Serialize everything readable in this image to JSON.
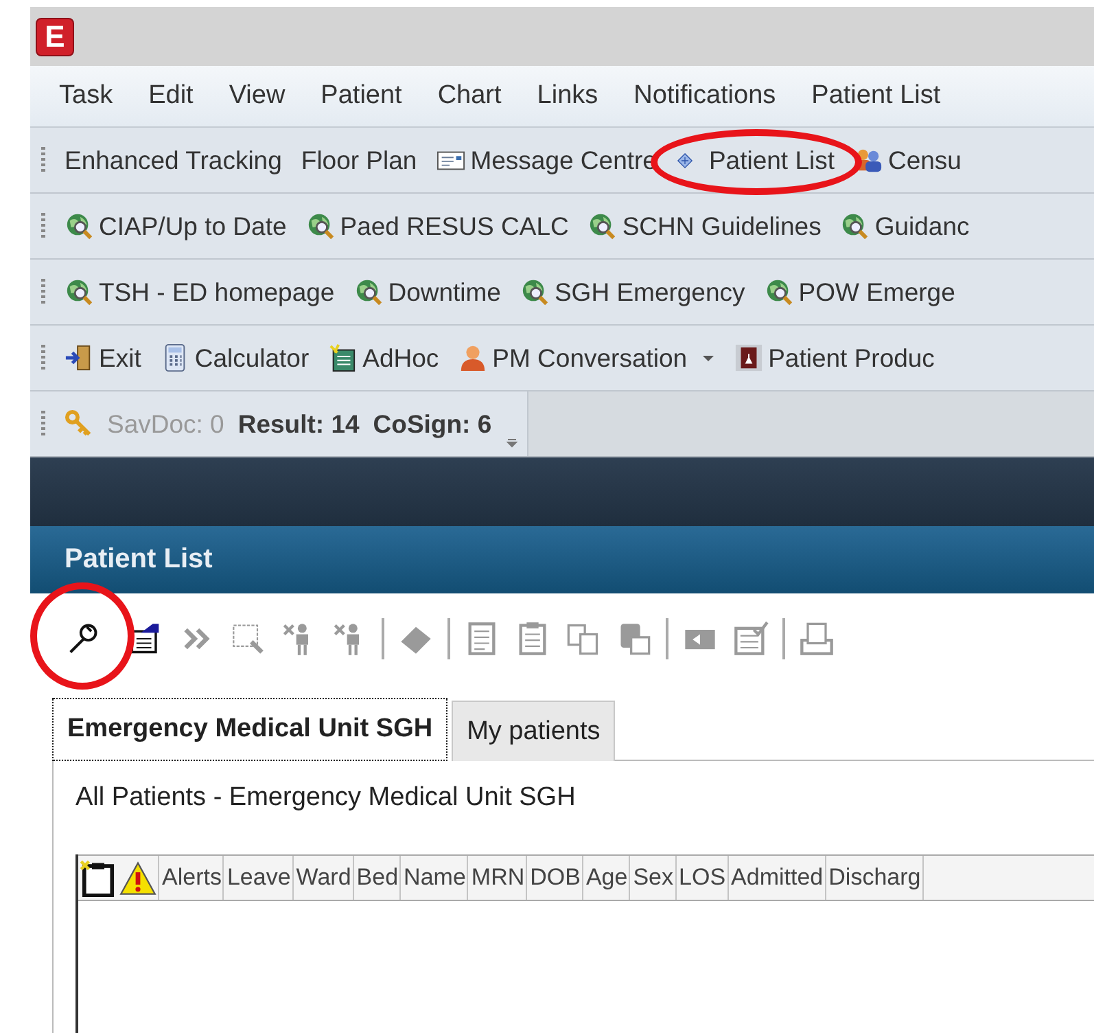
{
  "app_icon": {
    "letter": "E"
  },
  "annotations": [
    {
      "kind": "circle"
    },
    {
      "kind": "circle"
    }
  ],
  "menu": [
    "Task",
    "Edit",
    "View",
    "Patient",
    "Chart",
    "Links",
    "Notifications",
    "Patient List"
  ],
  "toolbars": [
    {
      "items": [
        {
          "label": "Enhanced Tracking",
          "kind": "plain",
          "dropdown": false
        },
        {
          "label": "Floor Plan",
          "kind": "plain",
          "dropdown": false
        },
        {
          "label": "Message Centre",
          "kind": "mail",
          "dropdown": false
        },
        {
          "label": "Patient List",
          "kind": "network",
          "dropdown": false
        },
        {
          "label": "Censu",
          "kind": "people",
          "dropdown": false
        }
      ]
    },
    {
      "items": [
        {
          "label": "CIAP/Up to Date",
          "kind": "globe",
          "dropdown": false
        },
        {
          "label": "Paed RESUS CALC",
          "kind": "globe",
          "dropdown": false
        },
        {
          "label": "SCHN Guidelines",
          "kind": "globe",
          "dropdown": false
        },
        {
          "label": "Guidanc",
          "kind": "globe",
          "dropdown": false
        }
      ]
    },
    {
      "items": [
        {
          "label": "TSH - ED homepage",
          "kind": "globe",
          "dropdown": false
        },
        {
          "label": "Downtime",
          "kind": "globe",
          "dropdown": false
        },
        {
          "label": "SGH Emergency",
          "kind": "globe",
          "dropdown": false
        },
        {
          "label": "POW Emerge",
          "kind": "globe",
          "dropdown": false
        }
      ]
    },
    {
      "items": [
        {
          "label": "Exit",
          "kind": "exit",
          "dropdown": false
        },
        {
          "label": "Calculator",
          "kind": "calculator",
          "dropdown": false
        },
        {
          "label": "AdHoc",
          "kind": "adhoc",
          "dropdown": false
        },
        {
          "label": "PM Conversation",
          "kind": "person",
          "dropdown": true
        },
        {
          "label": "Patient Produc",
          "kind": "book",
          "dropdown": false
        }
      ]
    }
  ],
  "status": [
    {
      "label": "SavDoc: 0",
      "disabled": true
    },
    {
      "label": "Result: 14",
      "disabled": false
    },
    {
      "label": "CoSign: 6",
      "disabled": false
    }
  ],
  "panel": {
    "title": "Patient List",
    "tools": [
      {
        "kind": "wrench",
        "disabled": false
      },
      {
        "kind": "properties",
        "disabled": false
      },
      {
        "kind": "chevrons",
        "disabled": true
      },
      {
        "kind": "search",
        "disabled": true
      },
      {
        "kind": "person",
        "disabled": true
      },
      {
        "kind": "person",
        "disabled": true
      },
      {
        "kind": "separator"
      },
      {
        "kind": "tag",
        "disabled": true
      },
      {
        "kind": "separator"
      },
      {
        "kind": "checklist",
        "disabled": true
      },
      {
        "kind": "clipboard",
        "disabled": true
      },
      {
        "kind": "copy",
        "disabled": true
      },
      {
        "kind": "paste",
        "disabled": true
      },
      {
        "kind": "separator"
      },
      {
        "kind": "back",
        "disabled": true
      },
      {
        "kind": "form",
        "disabled": true
      },
      {
        "kind": "separator"
      },
      {
        "kind": "print",
        "disabled": true
      }
    ],
    "tabs": [
      {
        "label": "Emergency Medical Unit SGH",
        "selected": true
      },
      {
        "label": "My patients",
        "selected": false
      }
    ],
    "list_title": "All Patients - Emergency Medical Unit SGH",
    "columns": [
      {
        "kind": "icon"
      },
      {
        "kind": "icon"
      },
      {
        "label": "Alerts"
      },
      {
        "label": "Leave"
      },
      {
        "label": "Ward"
      },
      {
        "label": "Bed"
      },
      {
        "label": "Name"
      },
      {
        "label": "MRN"
      },
      {
        "label": "DOB"
      },
      {
        "label": "Age"
      },
      {
        "label": "Sex"
      },
      {
        "label": "LOS"
      },
      {
        "label": "Admitted"
      },
      {
        "label": "Discharg"
      }
    ]
  }
}
